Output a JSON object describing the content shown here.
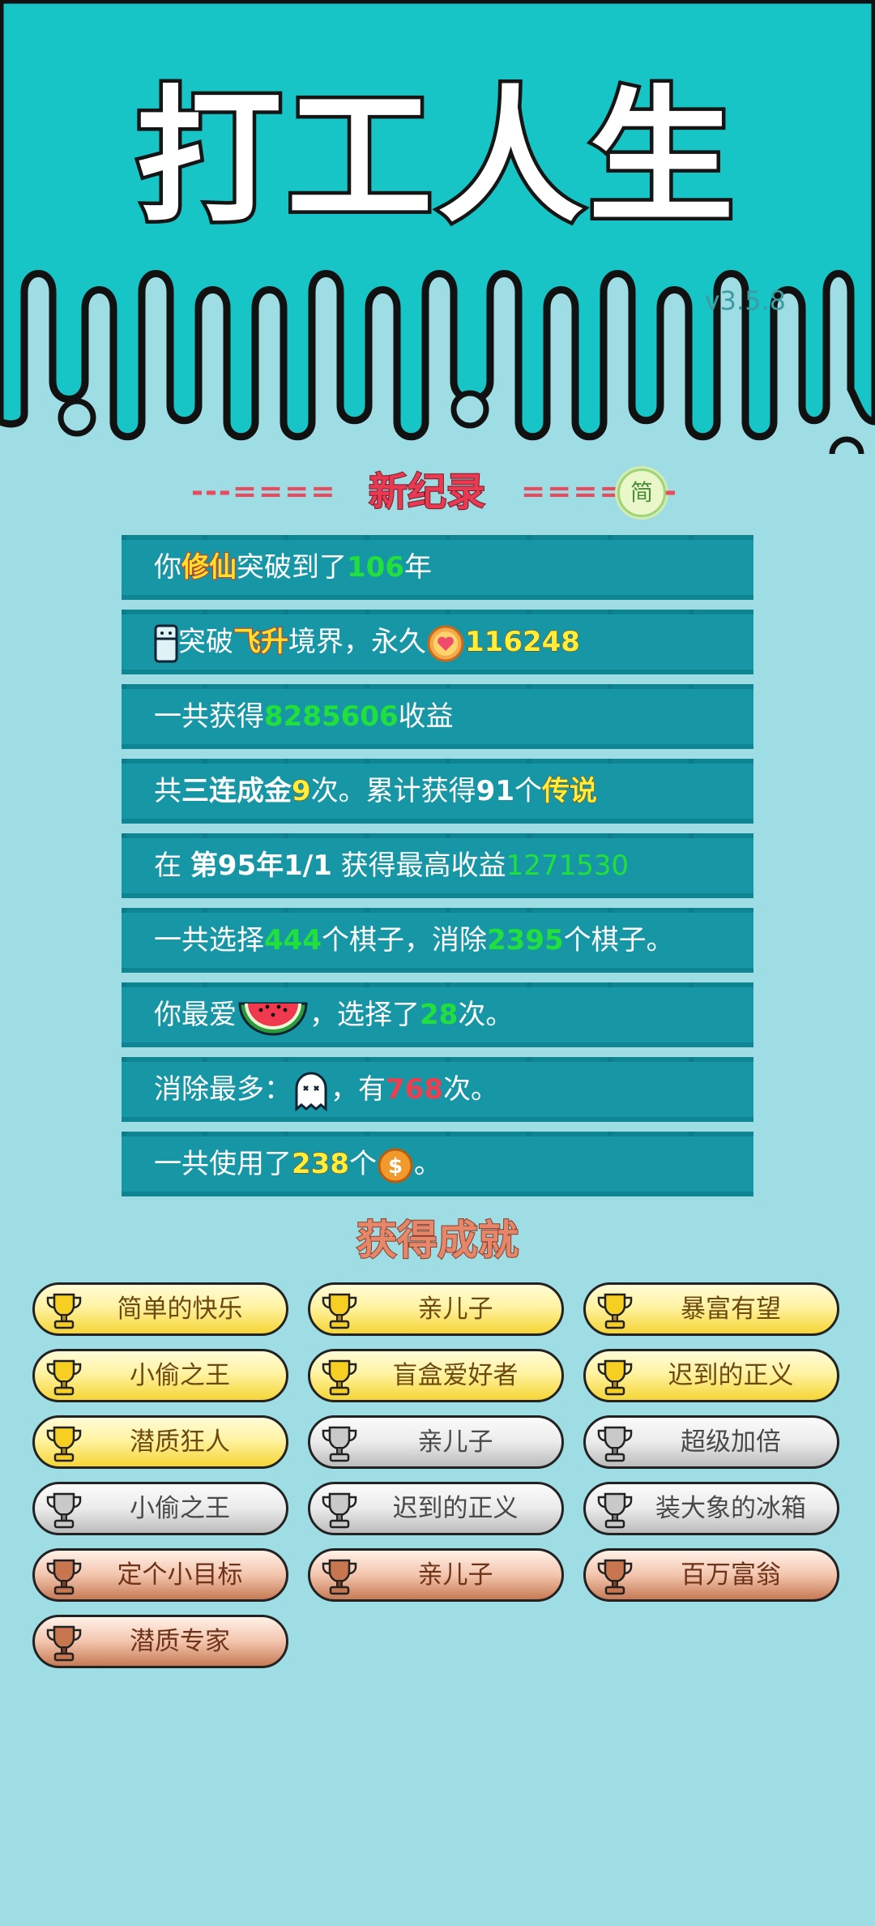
{
  "header": {
    "title": "打工人生",
    "version": "v3.5.8"
  },
  "record": {
    "dash_left": "---====",
    "title": "新纪录",
    "dash_right": "====",
    "simplify_label": "简",
    "simplify_tail": "-"
  },
  "stats": {
    "row1": {
      "a": "你",
      "b": "修仙",
      "c": "突破到了",
      "d": "106",
      "e": "年"
    },
    "row2": {
      "a": "突破",
      "b": "飞升",
      "c": "境界，永久",
      "d": "116248"
    },
    "row3": {
      "a": "一共获得",
      "b": "8285606",
      "c": "收益"
    },
    "row4": {
      "a": "共",
      "b": "三连成金",
      "c": "9",
      "d": "次。累计获得",
      "e": "91",
      "f": "个",
      "g": "传说"
    },
    "row5": {
      "a": "在 ",
      "b": "第95年1/1",
      "c": " 获得最高收益",
      "d": "1271530"
    },
    "row6": {
      "a": "一共选择",
      "b": "444",
      "c": "个棋子，消除",
      "d": "2395",
      "e": "个棋子。"
    },
    "row7": {
      "a": "你最爱",
      "b": "，选择了",
      "c": "28",
      "d": "次。"
    },
    "row8": {
      "a": "消除最多：",
      "b": "，有",
      "c": "768",
      "d": "次。"
    },
    "row9": {
      "a": "一共使用了",
      "b": "238",
      "c": "个",
      "d": "。"
    }
  },
  "achievements": {
    "title": "获得成就",
    "items": [
      {
        "label": "简单的快乐",
        "tier": "gold"
      },
      {
        "label": "亲儿子",
        "tier": "gold"
      },
      {
        "label": "暴富有望",
        "tier": "gold"
      },
      {
        "label": "小偷之王",
        "tier": "gold"
      },
      {
        "label": "盲盒爱好者",
        "tier": "gold"
      },
      {
        "label": "迟到的正义",
        "tier": "gold"
      },
      {
        "label": "潜质狂人",
        "tier": "gold"
      },
      {
        "label": "亲儿子",
        "tier": "silver"
      },
      {
        "label": "超级加倍",
        "tier": "silver"
      },
      {
        "label": "小偷之王",
        "tier": "silver"
      },
      {
        "label": "迟到的正义",
        "tier": "silver"
      },
      {
        "label": "装大象的冰箱",
        "tier": "silver"
      },
      {
        "label": "定个小目标",
        "tier": "bronze"
      },
      {
        "label": "亲儿子",
        "tier": "bronze"
      },
      {
        "label": "百万富翁",
        "tier": "bronze"
      },
      {
        "label": "潜质专家",
        "tier": "bronze"
      }
    ]
  },
  "icons": {
    "fridge": "fridge-icon",
    "heart_coin": "heart-coin-icon",
    "watermelon": "watermelon-icon",
    "ghost": "ghost-icon",
    "coin": "dollar-coin-icon",
    "trophy": "trophy-icon"
  },
  "colors": {
    "top_bg": "#17c4c6",
    "page_bg": "#9fdde4",
    "row_bg": "#1797a6",
    "accent_red": "#e83a52",
    "green": "#22e03b"
  }
}
